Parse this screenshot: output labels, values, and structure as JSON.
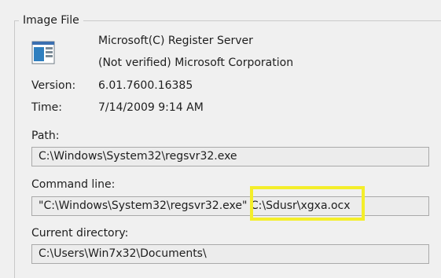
{
  "group": {
    "title": "Image File"
  },
  "image": {
    "description": "Microsoft(C) Register Server",
    "company": "(Not verified) Microsoft Corporation",
    "icon": "application-window-icon"
  },
  "version": {
    "label": "Version:",
    "value": "6.01.7600.16385"
  },
  "time": {
    "label": "Time:",
    "value": "7/14/2009 9:14 AM"
  },
  "path": {
    "label": "Path:",
    "value": "C:\\Windows\\System32\\regsvr32.exe"
  },
  "command_line": {
    "label": "Command line:",
    "value": "\"C:\\Windows\\System32\\regsvr32.exe\" C:\\Sdusr\\xgxa.ocx"
  },
  "current_directory": {
    "label": "Current directory:",
    "value": "C:\\Users\\Win7x32\\Documents\\"
  },
  "colors": {
    "highlight": "#f4ee2a",
    "field_border": "#a9a9a9",
    "background": "#f0f0f0"
  }
}
